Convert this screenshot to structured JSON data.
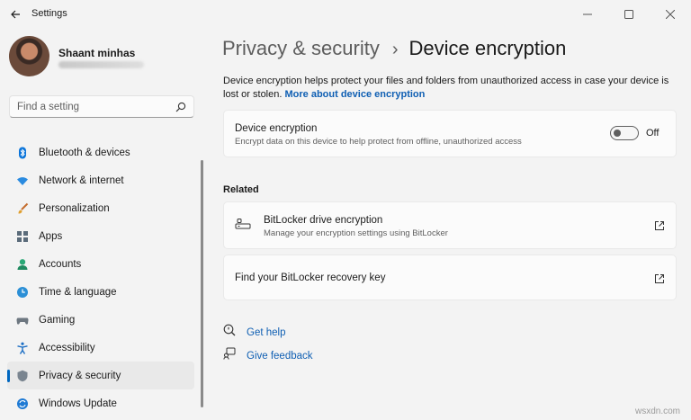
{
  "window": {
    "title": "Settings",
    "controls": {
      "minimize": "minimize-icon",
      "maximize": "maximize-icon",
      "close": "close-icon"
    }
  },
  "profile": {
    "name": "Shaant minhas"
  },
  "search": {
    "placeholder": "Find a setting",
    "value": ""
  },
  "sidebar": {
    "items": [
      {
        "label": "Bluetooth & devices",
        "icon": "bluetooth-icon"
      },
      {
        "label": "Network & internet",
        "icon": "wifi-icon"
      },
      {
        "label": "Personalization",
        "icon": "paintbrush-icon"
      },
      {
        "label": "Apps",
        "icon": "apps-icon"
      },
      {
        "label": "Accounts",
        "icon": "account-icon"
      },
      {
        "label": "Time & language",
        "icon": "globe-clock-icon"
      },
      {
        "label": "Gaming",
        "icon": "gamepad-icon"
      },
      {
        "label": "Accessibility",
        "icon": "accessibility-icon"
      },
      {
        "label": "Privacy & security",
        "icon": "shield-icon",
        "active": true
      },
      {
        "label": "Windows Update",
        "icon": "update-icon"
      }
    ]
  },
  "header": {
    "parent": "Privacy & security",
    "separator": "›",
    "current": "Device encryption"
  },
  "intro": {
    "text": "Device encryption helps protect your files and folders from unauthorized access in case your device is lost or stolen.",
    "link": "More about device encryption"
  },
  "encryption_card": {
    "title": "Device encryption",
    "subtitle": "Encrypt data on this device to help protect from offline, unauthorized access",
    "toggle_state": "Off",
    "toggle_on": false
  },
  "related": {
    "heading": "Related",
    "items": [
      {
        "title": "BitLocker drive encryption",
        "subtitle": "Manage your encryption settings using BitLocker",
        "icon": "bitlocker-icon",
        "action_icon": "external-link-icon"
      },
      {
        "title": "Find your BitLocker recovery key",
        "action_icon": "external-link-icon"
      }
    ]
  },
  "help": {
    "get_help": "Get help",
    "give_feedback": "Give feedback"
  },
  "watermark": "wsxdn.com",
  "colors": {
    "background": "#f3f3f3",
    "card": "#fbfbfb",
    "accent": "#0067c0",
    "link": "#0f5fb3"
  }
}
